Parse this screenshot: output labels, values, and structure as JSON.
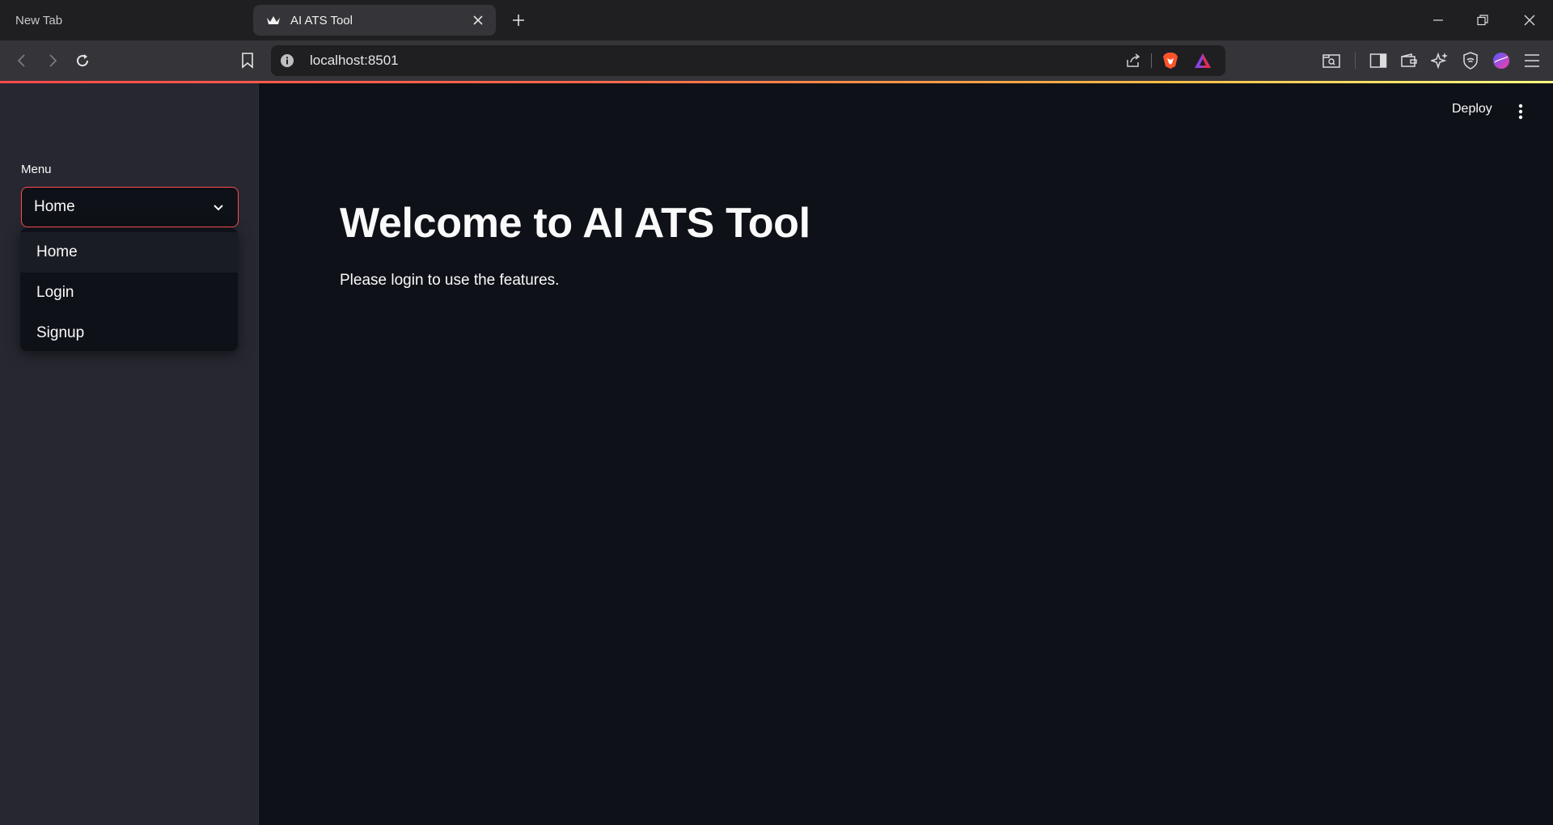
{
  "browser": {
    "tabs": [
      {
        "label": "New Tab"
      },
      {
        "label": "AI ATS Tool"
      }
    ],
    "url": "localhost:8501"
  },
  "sidebar": {
    "menu_label": "Menu",
    "select_value": "Home",
    "options": [
      "Home",
      "Login",
      "Signup"
    ]
  },
  "header": {
    "deploy_label": "Deploy"
  },
  "main": {
    "title": "Welcome to AI ATS Tool",
    "subtitle": "Please login to use the features."
  },
  "colors": {
    "accent": "#ff4b4b",
    "background": "#0e1117",
    "sidebar": "#262730"
  }
}
